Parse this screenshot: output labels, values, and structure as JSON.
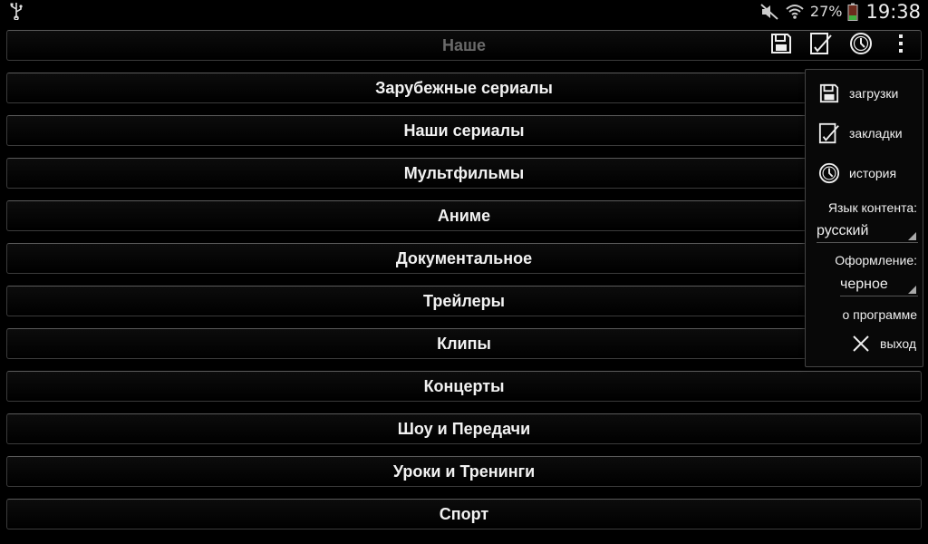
{
  "status_bar": {
    "battery_percent": "27%",
    "time": "19:38",
    "icons": [
      "usb-icon",
      "mute-icon",
      "wifi-icon",
      "battery-icon"
    ]
  },
  "action_bar": {
    "title": "Наше",
    "actions": [
      "save-icon",
      "bookmark-edit-icon",
      "clock-icon",
      "overflow-icon"
    ]
  },
  "categories": [
    "Зарубежные сериалы",
    "Наши сериалы",
    "Мультфильмы",
    "Аниме",
    "Документальное",
    "Трейлеры",
    "Клипы",
    "Концерты",
    "Шоу и Передачи",
    "Уроки и Тренинги",
    "Спорт"
  ],
  "menu": {
    "downloads": "загрузки",
    "bookmarks": "закладки",
    "history": "история",
    "content_language_label": "Язык контента:",
    "content_language_value": "русский",
    "theme_label": "Оформление:",
    "theme_value": "черное",
    "about": "о программе",
    "exit": "выход"
  },
  "colors": {
    "background": "#000000",
    "row_border": "#3b3b3b",
    "text": "#f2f2f2"
  }
}
